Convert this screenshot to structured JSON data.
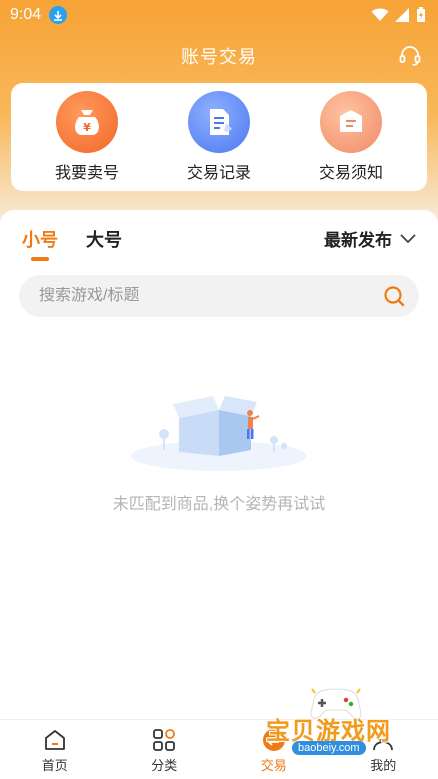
{
  "status_bar": {
    "time": "9:04"
  },
  "header": {
    "title": "账号交易",
    "support_icon": "headset-icon"
  },
  "quick_actions": [
    {
      "label": "我要卖号",
      "icon": "money-bag-icon"
    },
    {
      "label": "交易记录",
      "icon": "document-edit-icon"
    },
    {
      "label": "交易须知",
      "icon": "notice-box-icon"
    }
  ],
  "tabs": [
    {
      "label": "小号",
      "active": true
    },
    {
      "label": "大号",
      "active": false
    }
  ],
  "sort": {
    "label": "最新发布"
  },
  "search": {
    "placeholder": "搜索游戏/标题",
    "value": ""
  },
  "empty_state": {
    "message": "未匹配到商品,换个姿势再试试"
  },
  "bottom_nav": [
    {
      "label": "首页",
      "icon": "home-icon"
    },
    {
      "label": "分类",
      "icon": "category-icon"
    },
    {
      "label": "交易",
      "icon": "trade-icon",
      "active": true
    },
    {
      "label": "我的",
      "icon": "user-icon"
    }
  ],
  "watermark": {
    "title": "宝贝游戏网",
    "url": "baobeiy.com"
  },
  "colors": {
    "accent": "#f07a14",
    "header_orange": "#f7a336"
  }
}
